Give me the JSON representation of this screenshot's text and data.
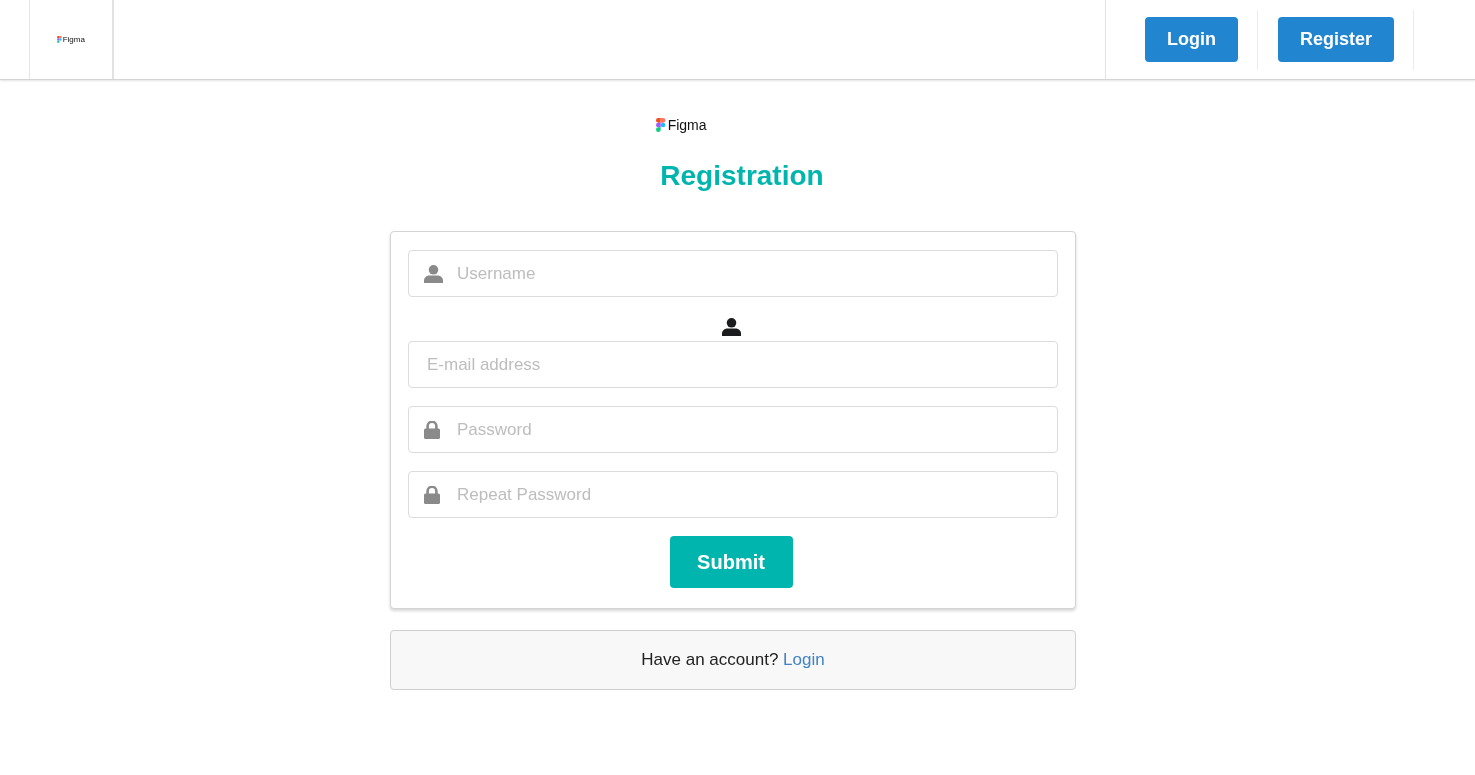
{
  "header": {
    "logo_text": "Figma",
    "buttons": [
      {
        "label": "Login"
      },
      {
        "label": "Register"
      }
    ]
  },
  "form_header": {
    "logo_text": "Figma",
    "title": "Registration"
  },
  "form": {
    "fields": [
      {
        "kind": "username",
        "placeholder": "Username"
      },
      {
        "kind": "email",
        "placeholder": "E-mail address"
      },
      {
        "kind": "password",
        "placeholder": "Password"
      },
      {
        "kind": "password",
        "placeholder": "Repeat Password"
      }
    ],
    "submit": "Submit"
  },
  "account_prompt": {
    "text": "Have an account?",
    "link": "Login"
  }
}
